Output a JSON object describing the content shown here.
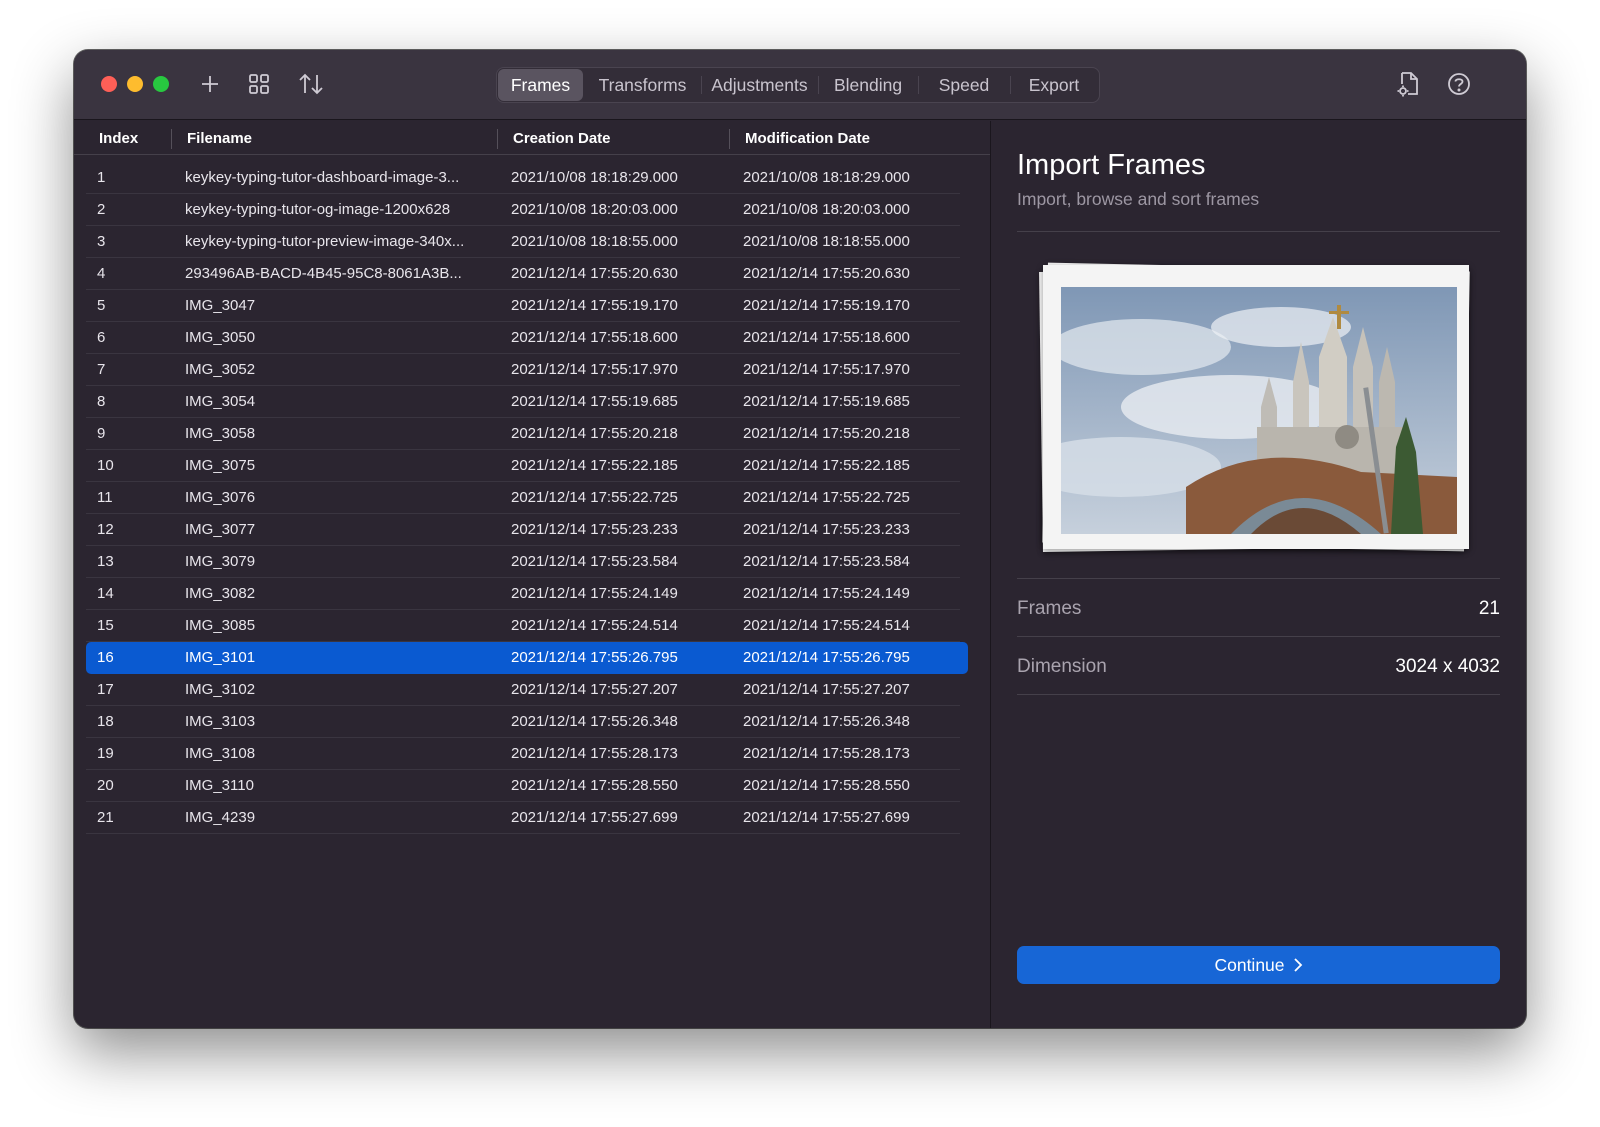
{
  "toolbar": {
    "icons": [
      "add-icon",
      "grid-icon",
      "sort-icon",
      "document-settings-icon",
      "help-icon"
    ],
    "tabs": [
      {
        "label": "Frames",
        "active": true
      },
      {
        "label": "Transforms",
        "active": false
      },
      {
        "label": "Adjustments",
        "active": false
      },
      {
        "label": "Blending",
        "active": false
      },
      {
        "label": "Speed",
        "active": false
      },
      {
        "label": "Export",
        "active": false
      }
    ]
  },
  "table": {
    "headers": {
      "index": "Index",
      "filename": "Filename",
      "creation": "Creation Date",
      "modification": "Modification Date"
    },
    "selected_index": "16",
    "rows": [
      {
        "index": "1",
        "filename": "keykey-typing-tutor-dashboard-image-3...",
        "creation": "2021/10/08 18:18:29.000",
        "modification": "2021/10/08 18:18:29.000"
      },
      {
        "index": "2",
        "filename": "keykey-typing-tutor-og-image-1200x628",
        "creation": "2021/10/08 18:20:03.000",
        "modification": "2021/10/08 18:20:03.000"
      },
      {
        "index": "3",
        "filename": "keykey-typing-tutor-preview-image-340x...",
        "creation": "2021/10/08 18:18:55.000",
        "modification": "2021/10/08 18:18:55.000"
      },
      {
        "index": "4",
        "filename": "293496AB-BACD-4B45-95C8-8061A3B...",
        "creation": "2021/12/14 17:55:20.630",
        "modification": "2021/12/14 17:55:20.630"
      },
      {
        "index": "5",
        "filename": "IMG_3047",
        "creation": "2021/12/14 17:55:19.170",
        "modification": "2021/12/14 17:55:19.170"
      },
      {
        "index": "6",
        "filename": "IMG_3050",
        "creation": "2021/12/14 17:55:18.600",
        "modification": "2021/12/14 17:55:18.600"
      },
      {
        "index": "7",
        "filename": "IMG_3052",
        "creation": "2021/12/14 17:55:17.970",
        "modification": "2021/12/14 17:55:17.970"
      },
      {
        "index": "8",
        "filename": "IMG_3054",
        "creation": "2021/12/14 17:55:19.685",
        "modification": "2021/12/14 17:55:19.685"
      },
      {
        "index": "9",
        "filename": "IMG_3058",
        "creation": "2021/12/14 17:55:20.218",
        "modification": "2021/12/14 17:55:20.218"
      },
      {
        "index": "10",
        "filename": "IMG_3075",
        "creation": "2021/12/14 17:55:22.185",
        "modification": "2021/12/14 17:55:22.185"
      },
      {
        "index": "11",
        "filename": "IMG_3076",
        "creation": "2021/12/14 17:55:22.725",
        "modification": "2021/12/14 17:55:22.725"
      },
      {
        "index": "12",
        "filename": "IMG_3077",
        "creation": "2021/12/14 17:55:23.233",
        "modification": "2021/12/14 17:55:23.233"
      },
      {
        "index": "13",
        "filename": "IMG_3079",
        "creation": "2021/12/14 17:55:23.584",
        "modification": "2021/12/14 17:55:23.584"
      },
      {
        "index": "14",
        "filename": "IMG_3082",
        "creation": "2021/12/14 17:55:24.149",
        "modification": "2021/12/14 17:55:24.149"
      },
      {
        "index": "15",
        "filename": "IMG_3085",
        "creation": "2021/12/14 17:55:24.514",
        "modification": "2021/12/14 17:55:24.514"
      },
      {
        "index": "16",
        "filename": "IMG_3101",
        "creation": "2021/12/14 17:55:26.795",
        "modification": "2021/12/14 17:55:26.795"
      },
      {
        "index": "17",
        "filename": "IMG_3102",
        "creation": "2021/12/14 17:55:27.207",
        "modification": "2021/12/14 17:55:27.207"
      },
      {
        "index": "18",
        "filename": "IMG_3103",
        "creation": "2021/12/14 17:55:26.348",
        "modification": "2021/12/14 17:55:26.348"
      },
      {
        "index": "19",
        "filename": "IMG_3108",
        "creation": "2021/12/14 17:55:28.173",
        "modification": "2021/12/14 17:55:28.173"
      },
      {
        "index": "20",
        "filename": "IMG_3110",
        "creation": "2021/12/14 17:55:28.550",
        "modification": "2021/12/14 17:55:28.550"
      },
      {
        "index": "21",
        "filename": "IMG_4239",
        "creation": "2021/12/14 17:55:27.699",
        "modification": "2021/12/14 17:55:27.699"
      }
    ]
  },
  "sidebar": {
    "title": "Import Frames",
    "subtitle": "Import, browse and sort frames",
    "frames_label": "Frames",
    "frames_value": "21",
    "dimension_label": "Dimension",
    "dimension_value": "3024 x 4032",
    "continue_label": "Continue",
    "continue_icon": "chevron-right-icon"
  },
  "colors": {
    "window_bg": "#2b2530",
    "titlebar_bg": "#3a3440",
    "selection": "#0a5ad1",
    "accent_button": "#1766d6"
  }
}
